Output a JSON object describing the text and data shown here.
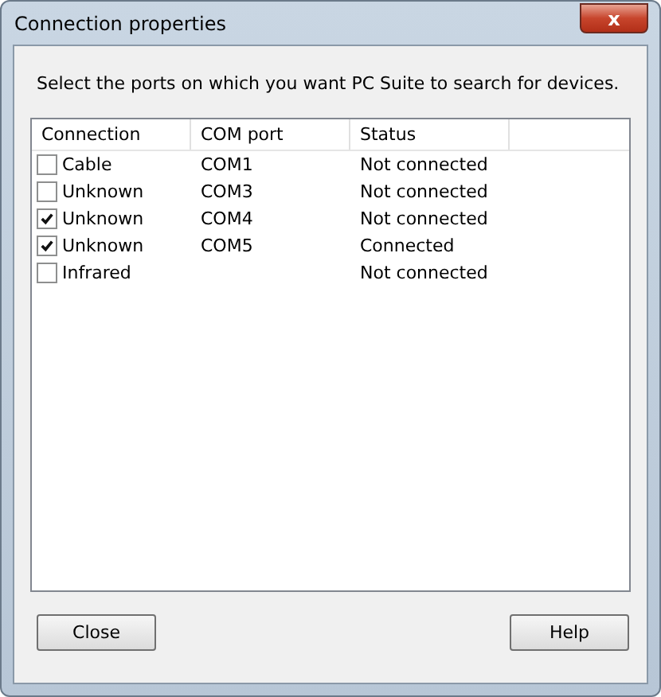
{
  "window": {
    "title": "Connection properties",
    "close_glyph": "x"
  },
  "instruction": "Select the ports on which you want PC Suite to search for devices.",
  "table": {
    "columns": [
      "Connection",
      "COM port",
      "Status"
    ],
    "rows": [
      {
        "connection": "Cable",
        "com_port": "COM1",
        "status": "Not connected",
        "checked": false
      },
      {
        "connection": "Unknown",
        "com_port": "COM3",
        "status": "Not connected",
        "checked": false
      },
      {
        "connection": "Unknown",
        "com_port": "COM4",
        "status": "Not connected",
        "checked": true
      },
      {
        "connection": "Unknown",
        "com_port": "COM5",
        "status": "Connected",
        "checked": true
      },
      {
        "connection": "Infrared",
        "status": "Not connected",
        "checked": false
      }
    ]
  },
  "buttons": [
    "Close",
    "Help"
  ]
}
